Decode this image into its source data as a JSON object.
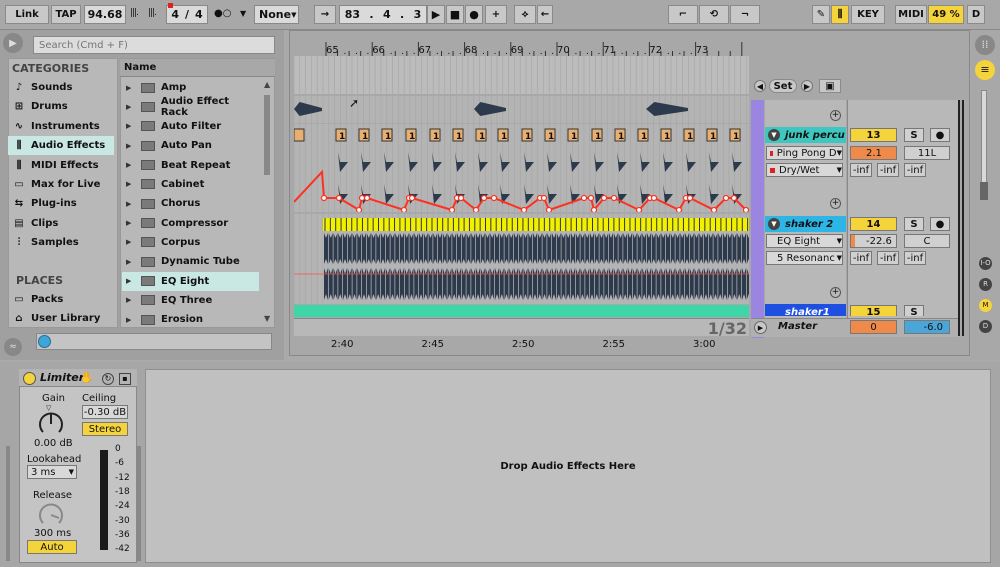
{
  "transport": {
    "link": "Link",
    "tap": "TAP",
    "tempo": "94.68",
    "time_sig_num": "4",
    "time_sig_den": "4",
    "quantize": "None",
    "pos_bar": "83",
    "pos_beat": "4",
    "pos_sixteenth": "3",
    "key_label": "KEY",
    "midi_label": "MIDI",
    "cpu": "49 %",
    "disk": "D"
  },
  "browser": {
    "search_placeholder": "Search (Cmd + F)",
    "categories_title": "CATEGORIES",
    "categories": [
      {
        "label": "Sounds",
        "icon": "note-icon"
      },
      {
        "label": "Drums",
        "icon": "grid-icon"
      },
      {
        "label": "Instruments",
        "icon": "wave-icon"
      },
      {
        "label": "Audio Effects",
        "icon": "fx-icon"
      },
      {
        "label": "MIDI Effects",
        "icon": "midi-fx-icon"
      },
      {
        "label": "Max for Live",
        "icon": "max-icon"
      },
      {
        "label": "Plug-ins",
        "icon": "plug-icon"
      },
      {
        "label": "Clips",
        "icon": "clip-icon"
      },
      {
        "label": "Samples",
        "icon": "sample-icon"
      }
    ],
    "places_title": "PLACES",
    "places": [
      {
        "label": "Packs",
        "icon": "packs-icon"
      },
      {
        "label": "User Library",
        "icon": "user-icon"
      }
    ],
    "column_header": "Name",
    "items": [
      "Amp",
      "Audio Effect Rack",
      "Auto Filter",
      "Auto Pan",
      "Beat Repeat",
      "Cabinet",
      "Chorus",
      "Compressor",
      "Corpus",
      "Dynamic Tube",
      "EQ Eight",
      "EQ Three",
      "Erosion"
    ],
    "selected_item": "EQ Eight"
  },
  "arrangement": {
    "bars": [
      "65",
      "66",
      "67",
      "68",
      "69",
      "70",
      "71",
      "72",
      "73"
    ],
    "times": [
      "2:40",
      "2:45",
      "2:50",
      "2:55",
      "3:00"
    ],
    "zoom": "1/32",
    "set_label": "Set"
  },
  "tracks": [
    {
      "name": "junk percu",
      "color": "#3ec7c1",
      "number": "13",
      "solo": "S",
      "device": "Ping Pong D",
      "param": "Dry/Wet",
      "volume": "2.1",
      "pan": "11L",
      "sends": [
        "-inf",
        "-inf",
        "-inf"
      ]
    },
    {
      "name": "shaker 2",
      "color": "#2db5e6",
      "number": "14",
      "solo": "S",
      "device": "EQ Eight",
      "param": "5 Resonanc",
      "volume": "-22.6",
      "pan": "C",
      "sends": [
        "-inf",
        "-inf",
        "-inf"
      ]
    },
    {
      "name": "shaker1",
      "color": "#1f4fe0",
      "number": "15",
      "solo": "S"
    }
  ],
  "master": {
    "name": "Master",
    "volume": "0",
    "pan": "-6.0"
  },
  "side_buttons": [
    "I-O",
    "R",
    "M",
    "D"
  ],
  "limiter": {
    "title": "Limiter",
    "gain_label": "Gain",
    "gain_value": "0.00 dB",
    "ceiling_label": "Ceiling",
    "ceiling_value": "-0.30 dB",
    "stereo": "Stereo",
    "lookahead_label": "Lookahead",
    "lookahead_value": "3 ms",
    "release_label": "Release",
    "release_value": "300 ms",
    "auto": "Auto",
    "meter_scale": [
      "0",
      "-6",
      "-12",
      "-18",
      "-24",
      "-30",
      "-36",
      "-42"
    ]
  },
  "dropzone": {
    "text": "Drop Audio Effects Here"
  },
  "colors": {
    "accent_yellow": "#f5d33a",
    "selection": "#c9e8e4",
    "purple": "#9a86e0",
    "orange": "#f08a4b",
    "blue": "#4aa6d8"
  }
}
